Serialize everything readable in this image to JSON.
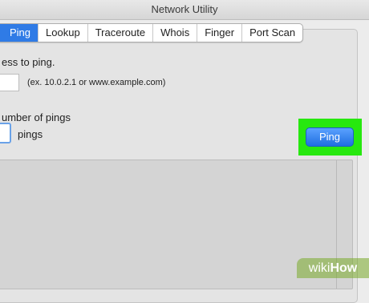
{
  "window": {
    "title": "Network Utility"
  },
  "tabs": [
    {
      "label": "Ping",
      "active": true
    },
    {
      "label": "Lookup",
      "active": false
    },
    {
      "label": "Traceroute",
      "active": false
    },
    {
      "label": "Whois",
      "active": false
    },
    {
      "label": "Finger",
      "active": false
    },
    {
      "label": "Port Scan",
      "active": false
    }
  ],
  "ping_form": {
    "address_prompt": "ess to ping.",
    "address_value": "",
    "address_hint": "(ex. 10.0.2.1 or www.example.com)",
    "count_prompt": "umber of pings",
    "count_value": "",
    "count_unit": "pings",
    "ping_button_label": "Ping"
  },
  "output": {
    "text": ""
  },
  "watermark": {
    "prefix": "wiki",
    "suffix": "How"
  },
  "colors": {
    "accent": "#2f7be6",
    "highlight": "#27e80f"
  }
}
